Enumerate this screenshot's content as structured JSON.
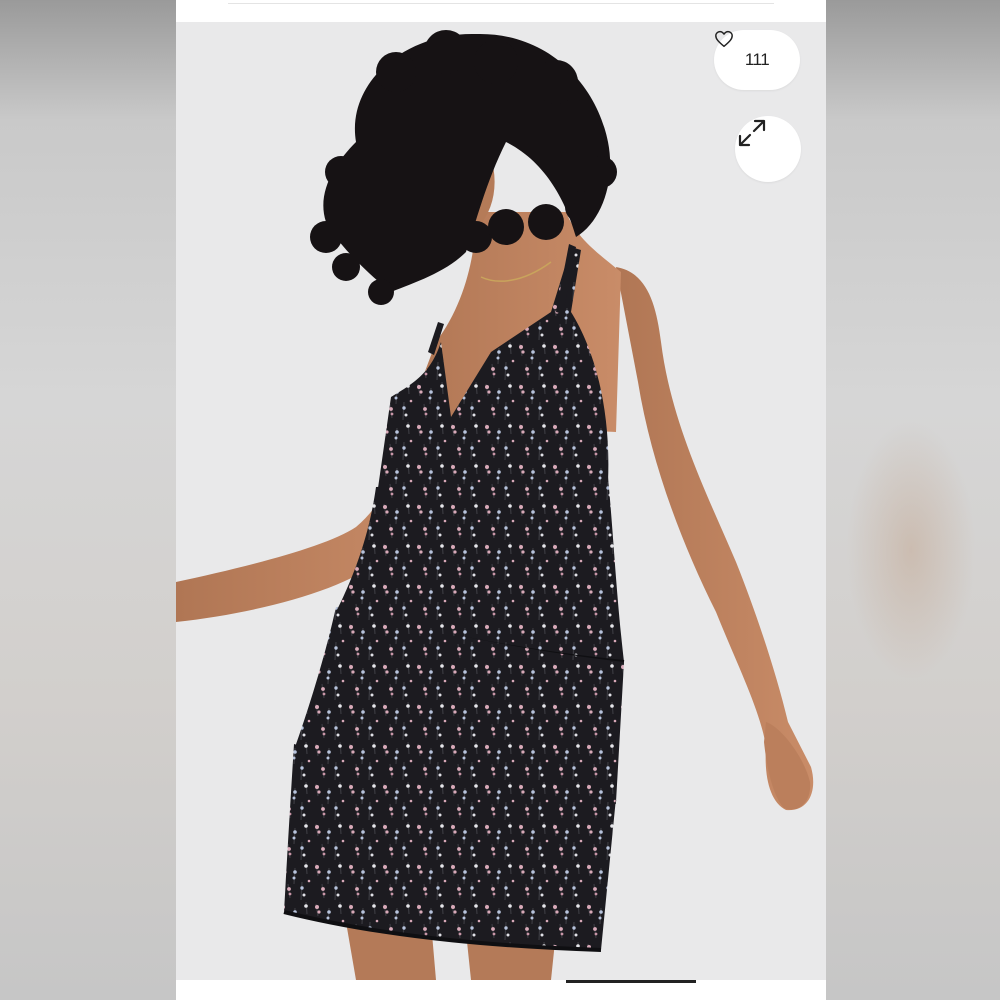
{
  "listing": {
    "likes_count": "111",
    "like_icon": "heart-outline-icon",
    "expand_icon": "expand-arrows-icon",
    "photo_description_icon": "product-photo"
  },
  "gallery": {
    "progress": 1.0
  },
  "colors": {
    "photo_background": "#e9e9ea",
    "dress_base": "#1c1b20",
    "print_pink": "#d8a9b8",
    "print_blue": "#b7c3dc",
    "button_background": "#ffffff",
    "text": "#222222"
  }
}
